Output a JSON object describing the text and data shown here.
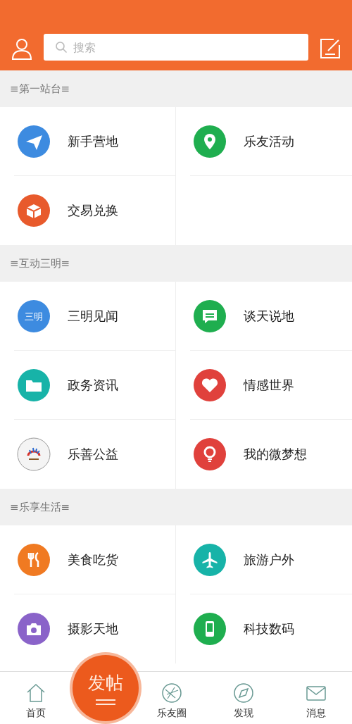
{
  "header": {
    "search": {
      "placeholder": "搜索"
    }
  },
  "sections": [
    {
      "title": "≡第一站台≡",
      "items": [
        {
          "label": "新手营地",
          "kind": "plane",
          "color": "#3d8be0"
        },
        {
          "label": "乐友活动",
          "kind": "pin",
          "color": "#1fae4f"
        },
        {
          "label": "交易兑换",
          "kind": "box",
          "color": "#e85a2c"
        }
      ]
    },
    {
      "title": "≡互动三明≡",
      "items": [
        {
          "label": "三明见闻",
          "kind": "badge",
          "color": "#3d8be0",
          "badge_text": "三明"
        },
        {
          "label": "谈天说地",
          "kind": "chat",
          "color": "#1fae4f"
        },
        {
          "label": "政务资讯",
          "kind": "folder",
          "color": "#17b3a8"
        },
        {
          "label": "情感世界",
          "kind": "heart",
          "color": "#e0413c"
        },
        {
          "label": "乐善公益",
          "kind": "logo",
          "color": "#f4f4f4"
        },
        {
          "label": "我的微梦想",
          "kind": "bulb",
          "color": "#e0413c"
        }
      ]
    },
    {
      "title": "≡乐享生活≡",
      "items": [
        {
          "label": "美食吃货",
          "kind": "fork",
          "color": "#f07a22"
        },
        {
          "label": "旅游户外",
          "kind": "airplane",
          "color": "#17b3a8"
        },
        {
          "label": "摄影天地",
          "kind": "camera",
          "color": "#8a63c9"
        },
        {
          "label": "科技数码",
          "kind": "phone",
          "color": "#1fae4f"
        }
      ]
    }
  ],
  "tabbar": [
    {
      "label": "首页",
      "kind": "home"
    },
    {
      "label": "发帖",
      "kind": "post"
    },
    {
      "label": "乐友圈",
      "kind": "aperture"
    },
    {
      "label": "发现",
      "kind": "compass"
    },
    {
      "label": "消息",
      "kind": "mail"
    }
  ]
}
